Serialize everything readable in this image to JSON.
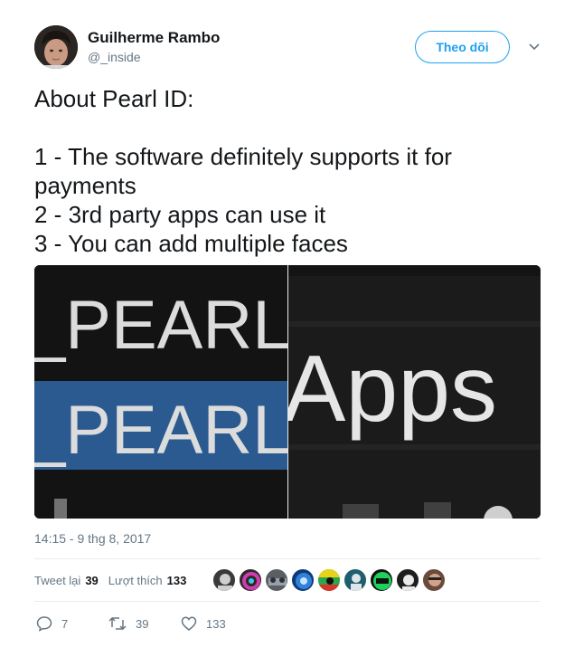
{
  "author": {
    "name": "Guilherme Rambo",
    "handle": "@_inside"
  },
  "follow_button_label": "Theo dõi",
  "tweet": {
    "lines": [
      "About Pearl ID:",
      "",
      "1 - The software definitely supports it for",
      "payments",
      "2 - 3rd party apps can use it",
      "3 - You can add multiple faces"
    ]
  },
  "media": {
    "left": {
      "rows": [
        "_PEARL_",
        "_PEARL_"
      ],
      "highlight_color": "#2a5a8f"
    },
    "right": {
      "text": "Apps"
    }
  },
  "timestamp": "14:15 - 9 thg 8, 2017",
  "stats": {
    "retweets_label": "Tweet lại",
    "retweets_count": "39",
    "likes_label": "Lượt thích",
    "likes_count": "133"
  },
  "likers_count": 9,
  "actions": {
    "replies": "7",
    "retweets": "39",
    "likes": "133"
  },
  "colors": {
    "accent": "#1da1f2",
    "secondary_text": "#657786"
  }
}
